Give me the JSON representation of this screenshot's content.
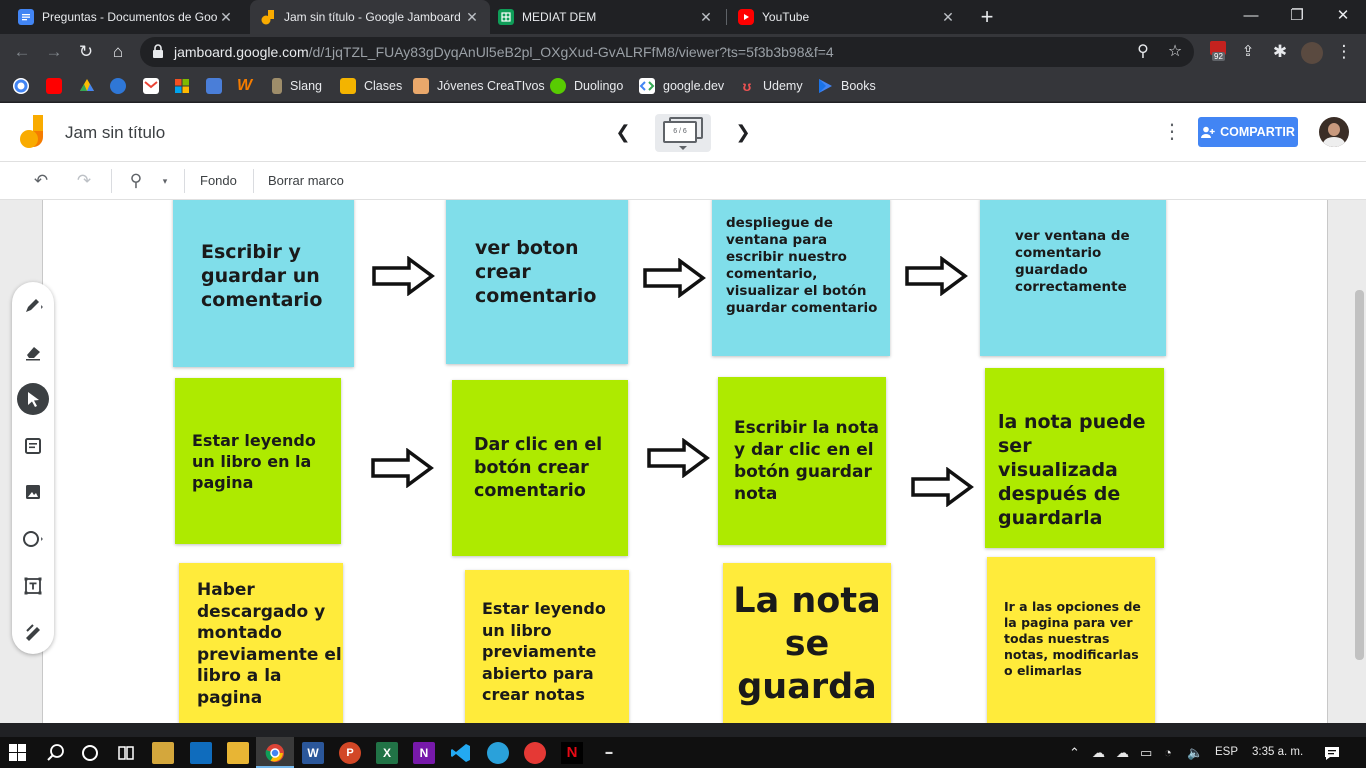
{
  "browser": {
    "tabs": [
      {
        "title": "Preguntas - Documentos de Goo",
        "favicon": "google-docs-icon",
        "color": "#4285f4",
        "active": false
      },
      {
        "title": "Jam sin título - Google Jamboard",
        "favicon": "jamboard-icon",
        "color": "#f9ab00",
        "active": true
      },
      {
        "title": "MEDIAT DEM",
        "favicon": "google-sheets-icon",
        "color": "#0f9d58",
        "active": false
      },
      {
        "title": "YouTube",
        "favicon": "youtube-icon",
        "color": "#ff0000",
        "active": false
      }
    ],
    "new_tab": "+",
    "url_host": "jamboard.google.com",
    "url_path": "/d/1jqTZL_FUAy83gDyqAnUl5eB2pl_OXgXud-GvALRFfM8/viewer?ts=5f3b3b98&f=4",
    "extension_badge": "92",
    "bookmarks": [
      {
        "label": "Slang",
        "icon": "slang-icon"
      },
      {
        "label": "Clases",
        "icon": "google-classroom-icon"
      },
      {
        "label": "Jóvenes CreaTIvos",
        "icon": "jovenes-creativos-icon"
      },
      {
        "label": "Duolingo",
        "icon": "duolingo-icon"
      },
      {
        "label": "google.dev",
        "icon": "google-dev-icon"
      },
      {
        "label": "Udemy",
        "icon": "udemy-icon"
      },
      {
        "label": "Books",
        "icon": "google-play-books-icon"
      }
    ]
  },
  "jamboard": {
    "title": "Jam sin título",
    "frame_indicator": "6 / 6",
    "share_label": "COMPARTIR",
    "toolbar": {
      "background": "Fondo",
      "clear_frame": "Borrar marco"
    }
  },
  "notes": {
    "row1": [
      "Escribir y guardar un comentario",
      "ver boton crear comentario",
      "despliegue de ventana para escribir nuestro comentario, visualizar el botón guardar comentario",
      "ver ventana de comentario guardado correctamente"
    ],
    "row2": [
      "Estar leyendo un libro en la pagina",
      "Dar clic en el botón crear comentario",
      "Escribir la nota y dar clic en el botón guardar nota",
      "la nota puede ser visualizada después de guardarla"
    ],
    "row3": [
      "Haber descargado y montado previamente el libro a la pagina",
      "Estar leyendo un libro previamente abierto para crear notas",
      "La nota se guarda",
      "Ir a las opciones de la pagina para ver todas nuestras notas, modificarlas o elimarlas"
    ]
  },
  "colors": {
    "blue_note": "#80deea",
    "green_note": "#aeea00",
    "yellow_note": "#ffeb3b",
    "share_button": "#4285f4"
  },
  "taskbar": {
    "language": "ESP",
    "time": "3:35 a. m."
  }
}
